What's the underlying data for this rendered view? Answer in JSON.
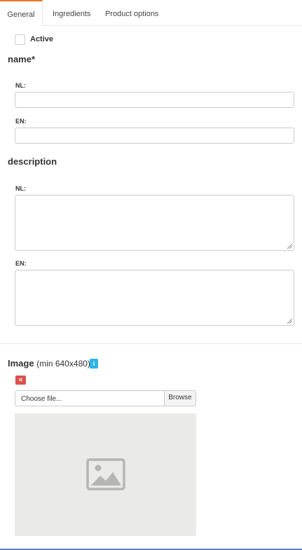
{
  "tabs": [
    {
      "label": "General",
      "active": true
    },
    {
      "label": "Ingredients",
      "active": false
    },
    {
      "label": "Product options",
      "active": false
    }
  ],
  "active_checkbox": {
    "label": "Active",
    "checked": false
  },
  "name_section": {
    "title": "name*",
    "fields": [
      {
        "lang": "NL:",
        "value": ""
      },
      {
        "lang": "EN:",
        "value": ""
      }
    ]
  },
  "description_section": {
    "title": "description",
    "fields": [
      {
        "lang": "NL:",
        "value": ""
      },
      {
        "lang": "EN:",
        "value": ""
      }
    ]
  },
  "image_section": {
    "title": "Image",
    "subtitle": "(min 640x480)",
    "info_icon": "i",
    "remove_icon": "×",
    "file_placeholder": "Choose file...",
    "browse_label": "Browse"
  },
  "colors": {
    "tab_accent": "#e87722",
    "info": "#2bb5e3",
    "danger": "#d9534f",
    "bottom_border": "#5b8ec9"
  }
}
